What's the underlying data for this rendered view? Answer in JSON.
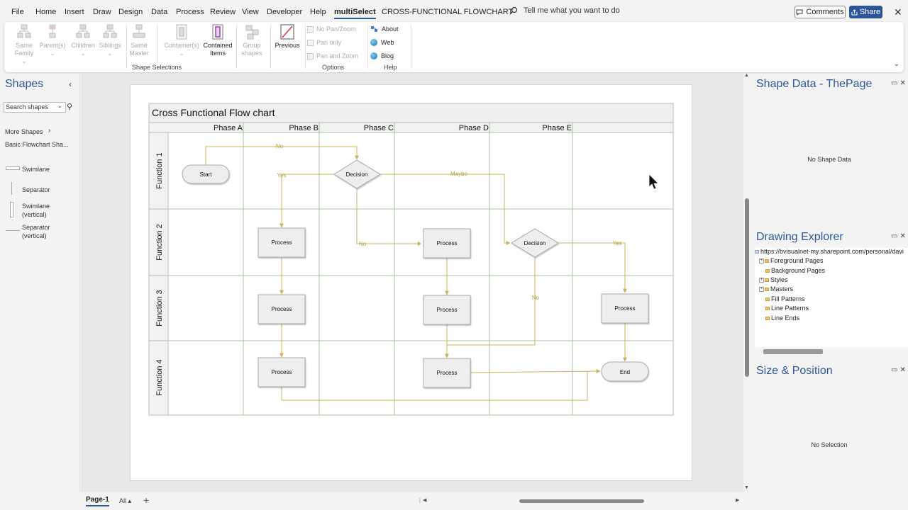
{
  "menu": {
    "items": [
      "File",
      "Home",
      "Insert",
      "Draw",
      "Design",
      "Data",
      "Process",
      "Review",
      "View",
      "Developer",
      "Help",
      "multiSelect"
    ],
    "active": "multiSelect",
    "doc_title": "CROSS-FUNCTIONAL FLOWCHART",
    "tell_me": "Tell me what you want to do",
    "comments": "Comments",
    "share": "Share"
  },
  "ribbon": {
    "shape_selections": {
      "label": "Shape Selections",
      "buttons": [
        {
          "l1": "Same",
          "l2": "Family",
          "enabled": false
        },
        {
          "l1": "Parent(s)",
          "l2": "",
          "enabled": false
        },
        {
          "l1": "Children",
          "l2": "",
          "enabled": false
        },
        {
          "l1": "Siblings",
          "l2": "",
          "enabled": false
        },
        {
          "l1": "Same",
          "l2": "Master",
          "enabled": false
        },
        {
          "l1": "Container(s)",
          "l2": "",
          "enabled": false
        },
        {
          "l1": "Contained",
          "l2": "Items",
          "enabled": true
        },
        {
          "l1": "Group",
          "l2": "shapes",
          "enabled": false
        },
        {
          "l1": "Previous",
          "l2": "",
          "enabled": true
        }
      ]
    },
    "options": {
      "label": "Options",
      "checks": [
        "No Pan/Zoom",
        "Pan only",
        "Pan and Zoom"
      ]
    },
    "help": {
      "label": "Help",
      "links": [
        "About",
        "Web",
        "Blog"
      ]
    }
  },
  "shapes_pane": {
    "title": "Shapes",
    "search_placeholder": "Search shapes",
    "more_shapes": "More Shapes",
    "stencil": "Basic Flowchart Sha...",
    "items": [
      {
        "l1": "Swimlane",
        "l2": ""
      },
      {
        "l1": "Separator",
        "l2": ""
      },
      {
        "l1": "Swimlane",
        "l2": "(vertical)"
      },
      {
        "l1": "Separator",
        "l2": "(vertical)"
      }
    ]
  },
  "diagram": {
    "title": "Cross Functional Flow chart",
    "phases": [
      "Phase A",
      "Phase B",
      "Phase C",
      "Phase D",
      "Phase E"
    ],
    "functions": [
      "Function 1",
      "Function 2",
      "Function 3",
      "Function 4"
    ],
    "shapes": {
      "start": "Start",
      "decision1": "Decision",
      "decision2": "Decision",
      "end": "End",
      "process": "Process"
    },
    "connector_labels": {
      "no_top": "No",
      "yes_left": "Yes",
      "maybe": "Maybe",
      "no_mid": "No",
      "yes_right": "Yes",
      "no_down": "No"
    }
  },
  "tabs": {
    "page1": "Page-1",
    "all": "All"
  },
  "right_panel": {
    "shape_data_title": "Shape Data - ThePage",
    "shape_data_empty": "No Shape Data",
    "drawing_explorer_title": "Drawing Explorer",
    "tree": [
      "https://bvisualnet-my.sharepoint.com/personal/davi",
      "Foreground Pages",
      "Background Pages",
      "Styles",
      "Masters",
      "Fill Patterns",
      "Line Patterns",
      "Line Ends"
    ],
    "size_position_title": "Size & Position",
    "size_position_empty": "No Selection"
  },
  "colors": {
    "accent": "#2b579a",
    "connector": "#c9b45a",
    "lane_border": "#a8c3a0"
  }
}
